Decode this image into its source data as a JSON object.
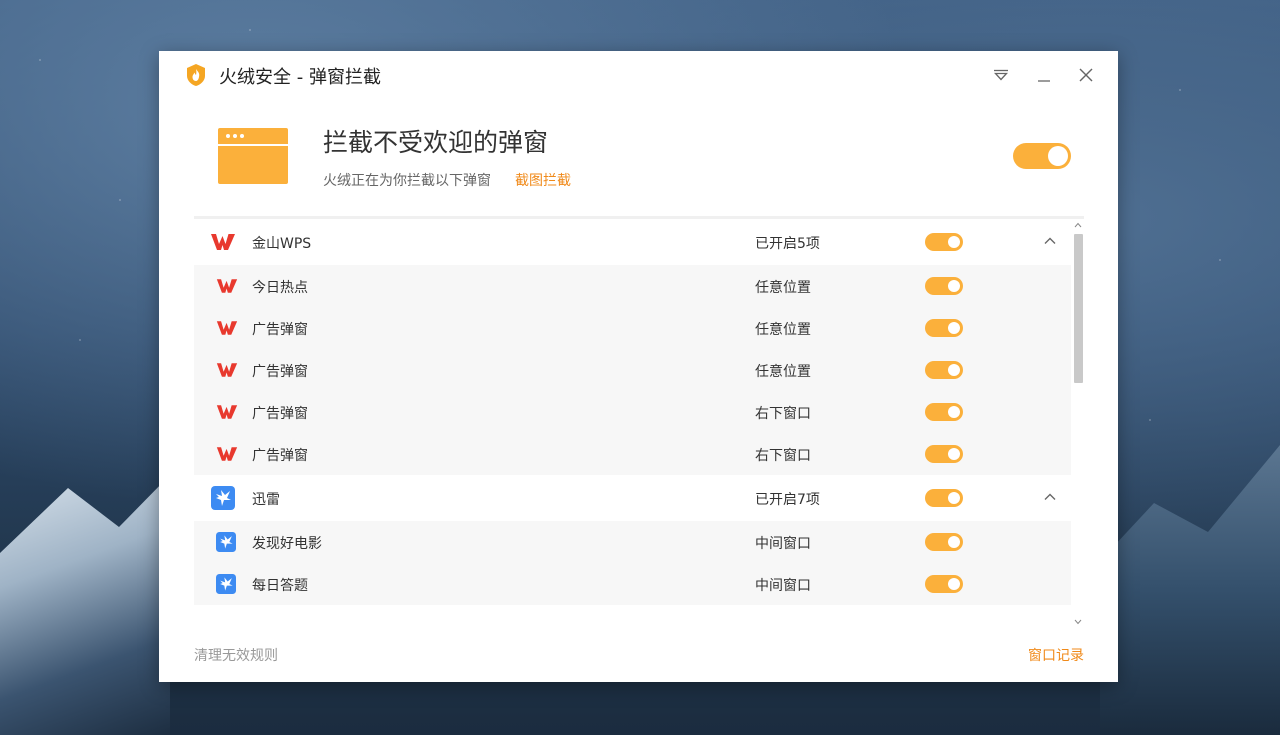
{
  "window": {
    "title": "火绒安全 - 弹窗拦截"
  },
  "header": {
    "title": "拦截不受欢迎的弹窗",
    "subtitle": "火绒正在为你拦截以下弹窗",
    "link": "截图拦截",
    "enabled": true
  },
  "groups": [
    {
      "name": "金山WPS",
      "status": "已开启5项",
      "icon": "wps-icon",
      "enabled": true,
      "expanded": true,
      "items": [
        {
          "name": "今日热点",
          "position": "任意位置",
          "enabled": true
        },
        {
          "name": "广告弹窗",
          "position": "任意位置",
          "enabled": true
        },
        {
          "name": "广告弹窗",
          "position": "任意位置",
          "enabled": true
        },
        {
          "name": "广告弹窗",
          "position": "右下窗口",
          "enabled": true
        },
        {
          "name": "广告弹窗",
          "position": "右下窗口",
          "enabled": true
        }
      ]
    },
    {
      "name": "迅雷",
      "status": "已开启7项",
      "icon": "xunlei-icon",
      "enabled": true,
      "expanded": true,
      "items": [
        {
          "name": "发现好电影",
          "position": "中间窗口",
          "enabled": true
        },
        {
          "name": "每日答题",
          "position": "中间窗口",
          "enabled": true
        }
      ]
    }
  ],
  "footer": {
    "clean": "清理无效规则",
    "history": "窗口记录"
  },
  "colors": {
    "accent": "#fbb03b",
    "link": "#f08a1a",
    "wps": "#e8392e",
    "xunlei": "#3d8bf2"
  }
}
